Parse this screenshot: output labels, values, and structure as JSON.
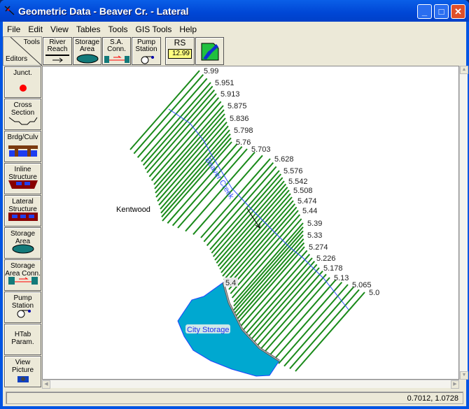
{
  "window": {
    "title": "Geometric Data - Beaver Cr.  - Lateral",
    "controls": [
      "minimize",
      "maximize",
      "close"
    ]
  },
  "menu": [
    "File",
    "Edit",
    "View",
    "Tables",
    "Tools",
    "GIS Tools",
    "Help"
  ],
  "toolbar": {
    "tools_label": "Tools",
    "editors_label": "Editors",
    "buttons": [
      {
        "label1": "River",
        "label2": "Reach"
      },
      {
        "label1": "Storage",
        "label2": "Area"
      },
      {
        "label1": "S.A.",
        "label2": "Conn."
      },
      {
        "label1": "Pump",
        "label2": "Station"
      },
      {
        "label1": "RS",
        "label2": "12.99"
      }
    ]
  },
  "editors": [
    {
      "l1": "Junct.",
      "l2": ""
    },
    {
      "l1": "Cross",
      "l2": "Section"
    },
    {
      "l1": "Brdg/Culv",
      "l2": ""
    },
    {
      "l1": "Inline",
      "l2": "Structure"
    },
    {
      "l1": "Lateral",
      "l2": "Structure"
    },
    {
      "l1": "Storage",
      "l2": "Area"
    },
    {
      "l1": "Storage",
      "l2": "Area Conn."
    },
    {
      "l1": "Pump",
      "l2": "Station"
    },
    {
      "l1": "HTab",
      "l2": "Param."
    },
    {
      "l1": "View",
      "l2": "Picture"
    }
  ],
  "map": {
    "river_label": "Beaver Creek",
    "town_label": "Kentwood",
    "storage_label": "City Storage",
    "lateral_label": "5.4",
    "cross_sections": [
      "5.99",
      "5.951",
      "5.913",
      "5.875",
      "5.836",
      "5.798",
      "5.76",
      "5.703",
      "5.628",
      "5.576",
      "5.542",
      "5.508",
      "5.474",
      "5.44",
      "5.39",
      "5.33",
      "5.274",
      "5.226",
      "5.178",
      "5.13",
      "5.065",
      "5.0"
    ],
    "colors": {
      "xs": "#1a8a1a",
      "river": "#3050ff",
      "storage": "#00a8d0",
      "storage_border": "#2040ff"
    }
  },
  "status": {
    "coords": "0.7012, 1.0728"
  }
}
